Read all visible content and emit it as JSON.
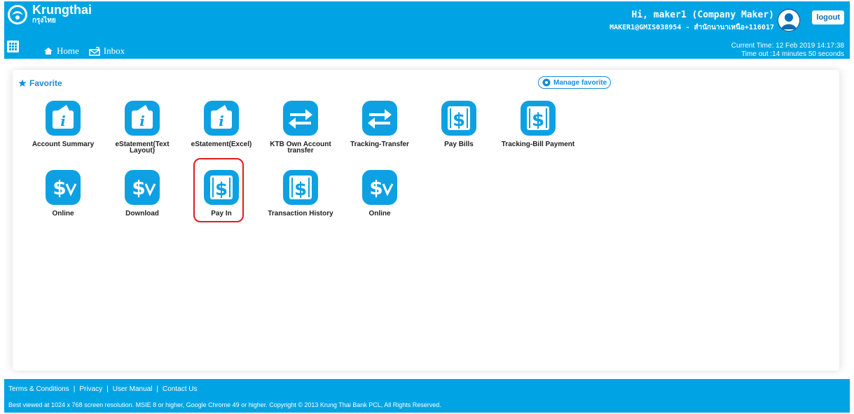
{
  "header": {
    "brand_name": "Krungthai",
    "brand_thai": "กรุงไทย",
    "greeting": "Hi, maker1 (Company Maker)",
    "user_sub": "MAKER1@GMIS038954 - สำนักนานาเหนือ+116017",
    "logout_label": "logout",
    "nav": [
      {
        "label": "Home",
        "icon": "home-icon"
      },
      {
        "label": "Inbox",
        "icon": "inbox-icon"
      }
    ],
    "current_time": "Current Time: 12 Feb 2019 14:17:38",
    "timeout": "Time out :14 minutes 50 seconds",
    "brand_color": "#00a4e4"
  },
  "favorite": {
    "title": "Favorite",
    "manage_label": "Manage favorite",
    "tiles": [
      {
        "label": "Account Summary",
        "icon": "info-icon"
      },
      {
        "label": "eStatement(Text Layout)",
        "icon": "info-icon"
      },
      {
        "label": "eStatement(Excel)",
        "icon": "info-icon"
      },
      {
        "label": "KTB Own Account transfer",
        "icon": "transfer-icon"
      },
      {
        "label": "Tracking-Transfer",
        "icon": "transfer-icon"
      },
      {
        "label": "Pay Bills",
        "icon": "dollar-barcode-icon"
      },
      {
        "label": "Tracking-Bill Payment",
        "icon": "dollar-barcode-icon"
      },
      {
        "label": "Online",
        "icon": "dollar-check-icon"
      },
      {
        "label": "Download",
        "icon": "dollar-check-icon"
      },
      {
        "label": "Pay In",
        "icon": "dollar-barcode-icon"
      },
      {
        "label": "Transaction History",
        "icon": "dollar-barcode-icon"
      },
      {
        "label": "Online",
        "icon": "dollar-check-icon"
      }
    ]
  },
  "footer": {
    "links": [
      "Terms & Conditions",
      "Privacy",
      "User Manual",
      "Contact Us"
    ],
    "copyright": "Best viewed at 1024 x 768 screen resolution. MSIE 8 or higher, Google Chrome 49 or higher. Copyright © 2013 Krung Thai Bank PCL, All Rights Reserved."
  }
}
